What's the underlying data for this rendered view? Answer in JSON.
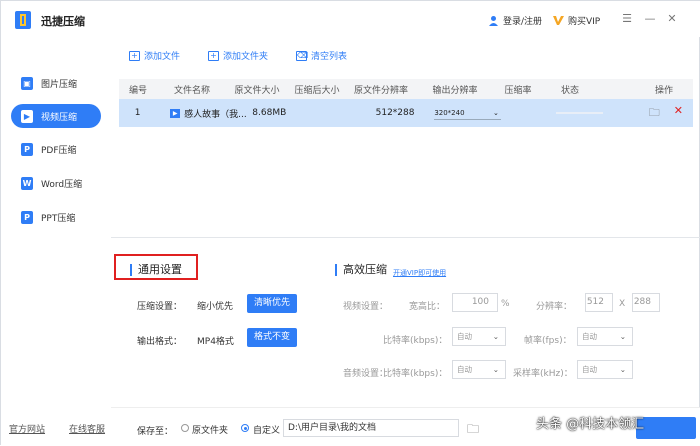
{
  "app": {
    "title": "迅捷压缩",
    "login": "登录/注册",
    "buy_vip": "购买VIP"
  },
  "sidebar": {
    "items": [
      {
        "label": "图片压缩",
        "icon": "image-icon"
      },
      {
        "label": "视频压缩",
        "icon": "video-icon"
      },
      {
        "label": "PDF压缩",
        "icon": "pdf-icon"
      },
      {
        "label": "Word压缩",
        "icon": "word-icon"
      },
      {
        "label": "PPT压缩",
        "icon": "ppt-icon"
      }
    ],
    "footer_left": "官方网站",
    "footer_right": "在线客服"
  },
  "toolbar": {
    "add_file": "添加文件",
    "add_folder": "添加文件夹",
    "clear_list": "清空列表"
  },
  "table": {
    "headers": [
      "编号",
      "文件名称",
      "原文件大小",
      "压缩后大小",
      "原文件分辨率",
      "输出分辨率",
      "压缩率",
      "状态",
      "操作"
    ],
    "row": {
      "index": "1",
      "name": "感人故事（我...",
      "orig_size": "8.68MB",
      "resolution": "512*288",
      "output_res": "320*240"
    }
  },
  "general": {
    "title": "通用设置",
    "compress_label": "压缩设置：",
    "compress_opt1": "缩小优先",
    "compress_opt2": "清晰优先",
    "format_label": "输出格式：",
    "format_value": "MP4格式",
    "format_btn": "格式不变"
  },
  "advanced": {
    "title": "高效压缩",
    "vip_link": "开通VIP即可使用",
    "video_label": "视频设置：",
    "width_ratio_label": "宽高比：",
    "width_ratio_value": "100",
    "percent": "%",
    "resolution_label": "分辨率：",
    "res_w": "512",
    "res_x": "X",
    "res_h": "288",
    "bitrate_label": "比特率(kbps)：",
    "bitrate_value": "自动",
    "fps_label": "帧率(fps)：",
    "fps_value": "自动",
    "audio_label": "音频设置：",
    "audio_bitrate_label": "比特率(kbps)：",
    "audio_bitrate_value": "自动",
    "sample_label": "采样率(kHz)：",
    "sample_value": "自动"
  },
  "bottom": {
    "save_to": "保存至：",
    "opt_original": "原文件夹",
    "opt_custom": "自定义",
    "path": "D:\\用户目录\\我的文档"
  },
  "watermark": "头条 @科技本领汇",
  "colors": {
    "accent": "#2f7df6",
    "row_selected": "#cfe3fb",
    "highlight_box": "#e02020"
  }
}
